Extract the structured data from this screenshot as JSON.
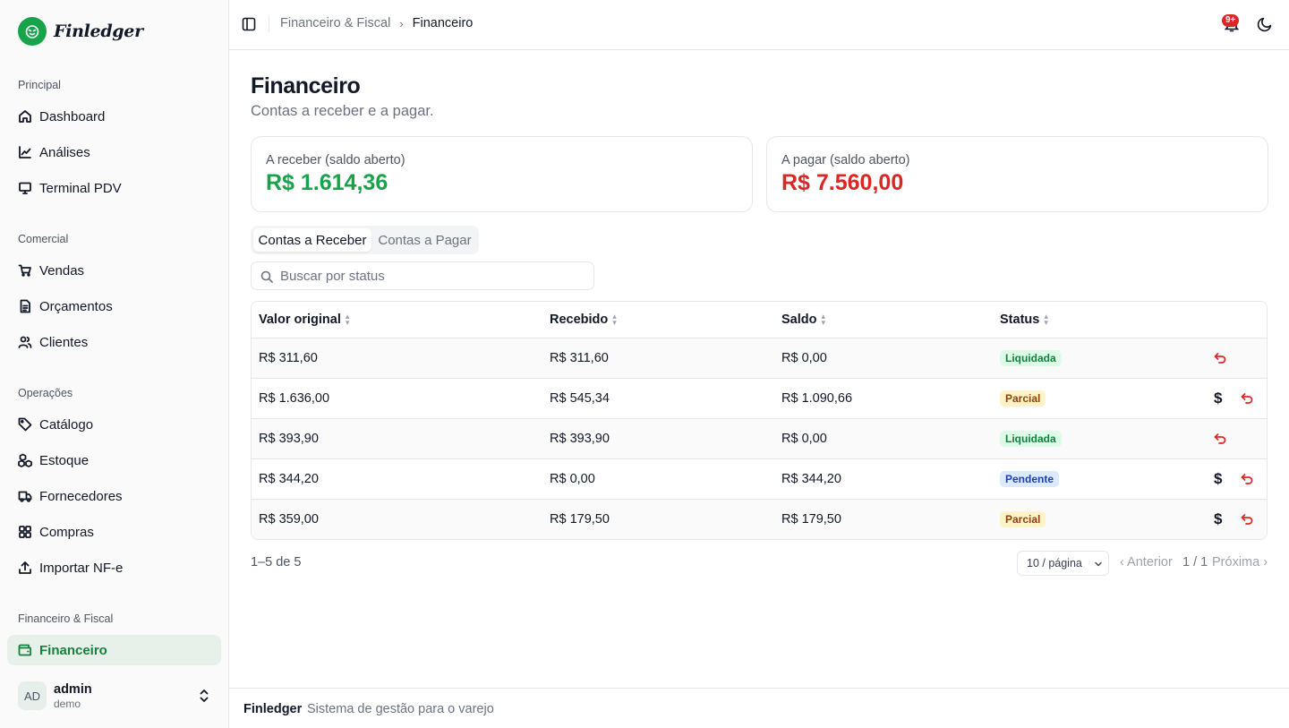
{
  "app": {
    "name": "Finledger"
  },
  "colors": {
    "accent": "#16a34a",
    "receivable": "#16a34a",
    "payable": "#dc2626",
    "undo": "#dc2626"
  },
  "sidebar": {
    "sections": [
      {
        "label": "Principal",
        "items": [
          {
            "label": "Dashboard",
            "icon": "home-icon"
          },
          {
            "label": "Análises",
            "icon": "line-chart-icon"
          },
          {
            "label": "Terminal PDV",
            "icon": "monitor-icon"
          }
        ]
      },
      {
        "label": "Comercial",
        "items": [
          {
            "label": "Vendas",
            "icon": "cart-icon"
          },
          {
            "label": "Orçamentos",
            "icon": "file-text-icon"
          },
          {
            "label": "Clientes",
            "icon": "users-icon"
          }
        ]
      },
      {
        "label": "Operações",
        "items": [
          {
            "label": "Catálogo",
            "icon": "tag-icon"
          },
          {
            "label": "Estoque",
            "icon": "boxes-icon"
          },
          {
            "label": "Fornecedores",
            "icon": "truck-icon"
          },
          {
            "label": "Compras",
            "icon": "grid-icon"
          },
          {
            "label": "Importar NF-e",
            "icon": "upload-icon"
          }
        ]
      },
      {
        "label": "Financeiro & Fiscal",
        "items": [
          {
            "label": "Financeiro",
            "icon": "wallet-icon",
            "active": true
          }
        ]
      }
    ],
    "user": {
      "initials": "AD",
      "name": "admin",
      "role": "demo"
    }
  },
  "header": {
    "breadcrumb": {
      "parent": "Financeiro & Fiscal",
      "current": "Financeiro"
    },
    "notification_count": "9+"
  },
  "page": {
    "title": "Financeiro",
    "subtitle": "Contas a receber e a pagar."
  },
  "summary": {
    "receivable": {
      "label": "A receber (saldo aberto)",
      "value": "R$ 1.614,36"
    },
    "payable": {
      "label": "A pagar (saldo aberto)",
      "value": "R$ 7.560,00"
    }
  },
  "tabs": [
    {
      "label": "Contas a Receber",
      "active": true
    },
    {
      "label": "Contas a Pagar",
      "active": false
    }
  ],
  "search": {
    "placeholder": "Buscar por status",
    "value": ""
  },
  "table": {
    "columns": [
      "Valor original",
      "Recebido",
      "Saldo",
      "Status"
    ],
    "rows": [
      {
        "original": "R$ 311,60",
        "received": "R$ 311,60",
        "balance": "R$ 0,00",
        "status": "Liquidada",
        "status_kind": "liq",
        "can_pay": false
      },
      {
        "original": "R$ 1.636,00",
        "received": "R$ 545,34",
        "balance": "R$ 1.090,66",
        "status": "Parcial",
        "status_kind": "par",
        "can_pay": true
      },
      {
        "original": "R$ 393,90",
        "received": "R$ 393,90",
        "balance": "R$ 0,00",
        "status": "Liquidada",
        "status_kind": "liq",
        "can_pay": false
      },
      {
        "original": "R$ 344,20",
        "received": "R$ 0,00",
        "balance": "R$ 344,20",
        "status": "Pendente",
        "status_kind": "pen",
        "can_pay": true
      },
      {
        "original": "R$ 359,00",
        "received": "R$ 179,50",
        "balance": "R$ 179,50",
        "status": "Parcial",
        "status_kind": "par",
        "can_pay": true
      }
    ]
  },
  "pagination": {
    "summary": "1–5 de 5",
    "per_page": "10 / página",
    "prev": "‹ Anterior",
    "page": "1 / 1",
    "next": "Próxima ›"
  },
  "footer": {
    "brand": "Finledger",
    "tagline": "Sistema de gestão para o varejo"
  }
}
